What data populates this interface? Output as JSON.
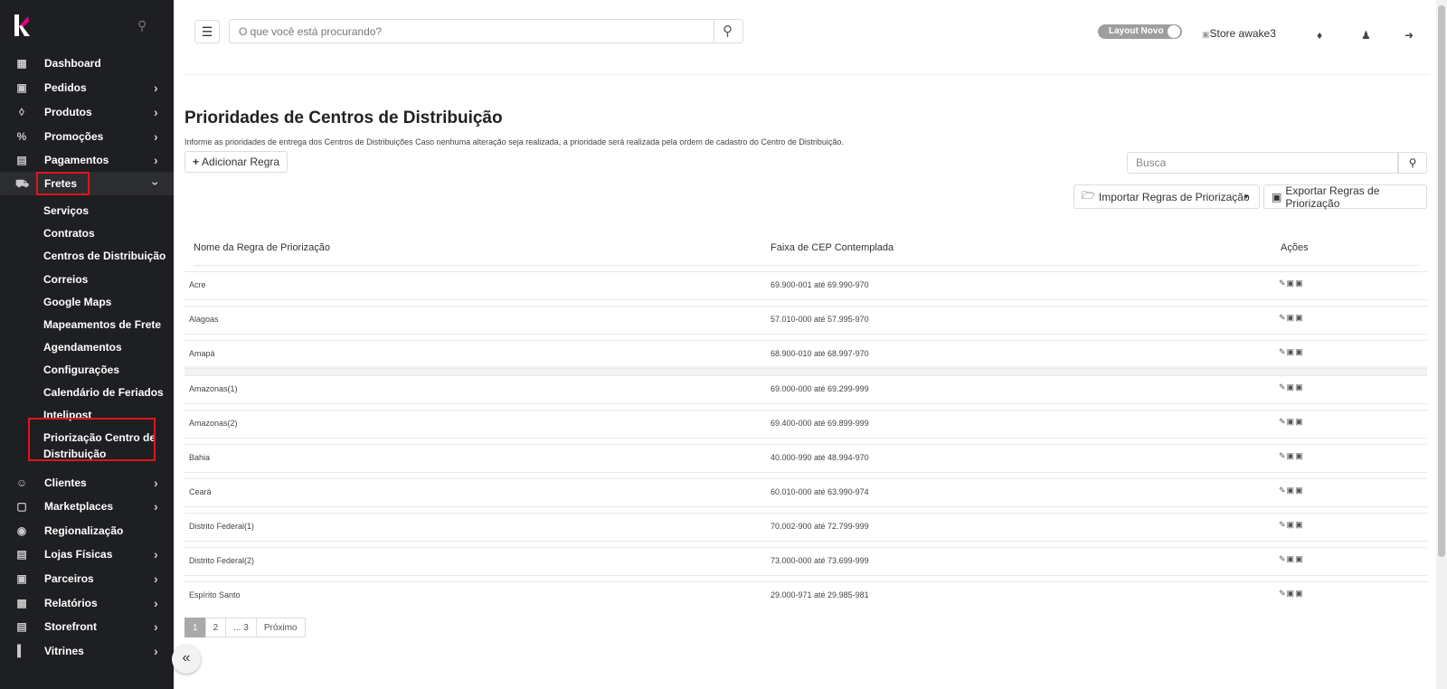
{
  "sidebar": {
    "logo": "K",
    "items": [
      {
        "label": "Dashboard",
        "icon": "dashboard-icon"
      },
      {
        "label": "Pedidos",
        "icon": "inbox-icon"
      },
      {
        "label": "Produtos",
        "icon": "tag-icon"
      },
      {
        "label": "Promoções",
        "icon": "percent-icon"
      },
      {
        "label": "Pagamentos",
        "icon": "money-icon"
      },
      {
        "label": "Fretes",
        "icon": "truck-icon"
      },
      {
        "label": "Clientes",
        "icon": "user-icon"
      },
      {
        "label": "Marketplaces",
        "icon": "bag-icon"
      },
      {
        "label": "Regionalização",
        "icon": "location-icon"
      },
      {
        "label": "Lojas Físicas",
        "icon": "store-icon"
      },
      {
        "label": "Parceiros",
        "icon": "briefcase-icon"
      },
      {
        "label": "Relatórios",
        "icon": "report-icon"
      },
      {
        "label": "Storefront",
        "icon": "storefront-icon"
      },
      {
        "label": "Vitrines",
        "icon": "paint-roller-icon"
      }
    ],
    "submenu": [
      "Serviços",
      "Contratos",
      "Centros de Distribuição",
      "Correios",
      "Google Maps",
      "Mapeamentos de Frete",
      "Agendamentos",
      "Configurações",
      "Calendário de Feriados",
      "Intelipost",
      "Priorização Centro de",
      "Distribuição"
    ]
  },
  "header": {
    "search_placeholder": "O que você está procurando?",
    "toggle_label": "Layout Novo",
    "store_alt": "Store awake3"
  },
  "main": {
    "title": "Prioridades de Centros de Distribuição",
    "description": "Informe as prioridades de entrega dos Centros de Distribuições Caso nenhuma alteração seja realizada, a prioridade será realizada pela ordem de cadastro do Centro de Distribuição.",
    "add_button": "Adicionar Regra",
    "search_placeholder": "Busca",
    "import_button": "Importar Regras de Priorização",
    "export_button": "Exportar Regras de Priorização",
    "columns": [
      "Nome da Regra de Priorização",
      "Faixa de CEP Contemplada",
      "Ações"
    ],
    "rows": [
      {
        "name": "Acre",
        "cep": "69.900-001 até 69.990-970"
      },
      {
        "name": "Alagoas",
        "cep": "57.010-000 até 57.995-970"
      },
      {
        "name": "Amapá",
        "cep": "68.900-010 até 68.997-970"
      },
      {
        "name": "Amazonas(1)",
        "cep": "69.000-000 até 69.299-999"
      },
      {
        "name": "Amazonas(2)",
        "cep": "69.400-000 até 69.899-999"
      },
      {
        "name": "Bahia",
        "cep": "40.000-990 até 48.994-970"
      },
      {
        "name": "Ceará",
        "cep": "60.010-000 até 63.990-974"
      },
      {
        "name": "Distrito Federal(1)",
        "cep": "70.002-900 até 72.799-999"
      },
      {
        "name": "Distrito Federal(2)",
        "cep": "73.000-000 até 73.699-999"
      },
      {
        "name": "Espírito Santo",
        "cep": "29.000-971 até 29.985-981"
      }
    ],
    "pagination": [
      "1",
      "2",
      "... 3",
      "Próximo"
    ]
  },
  "colors": {
    "sidebar_bg": "#1e1f22",
    "highlight": "#e0141e",
    "page_active": "#a9a9a9"
  }
}
